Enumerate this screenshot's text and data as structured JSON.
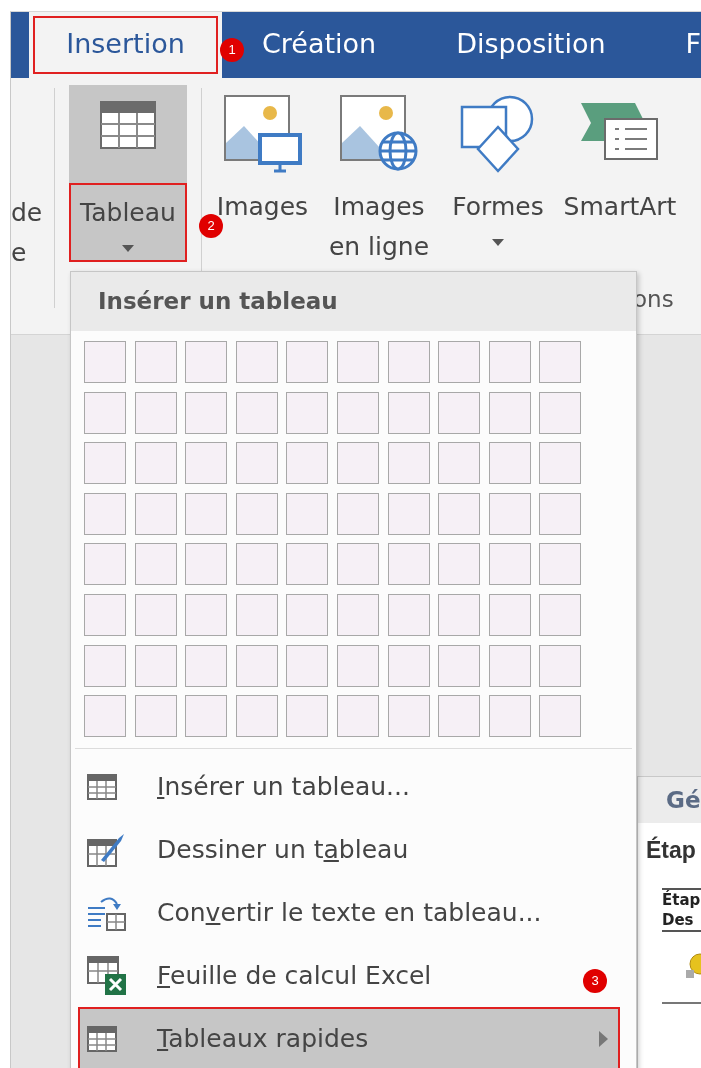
{
  "tabs": [
    {
      "label": "Insertion",
      "selected": true,
      "highlighted": true,
      "callout": "1"
    },
    {
      "label": "Création",
      "selected": false,
      "highlighted": false
    },
    {
      "label": "Disposition",
      "selected": false,
      "highlighted": false
    },
    {
      "label": "F",
      "selected": false,
      "highlighted": false
    }
  ],
  "ribbon": {
    "cut_group": {
      "lines": [
        "de",
        "e"
      ]
    },
    "buttons": [
      {
        "kind": "table",
        "lines": [
          "Tableau"
        ],
        "dropdown": true,
        "pressed": true,
        "highlighted": true,
        "callout": "2"
      },
      {
        "kind": "pictures",
        "lines": [
          "Images"
        ],
        "dropdown": false,
        "pressed": false,
        "highlighted": false
      },
      {
        "kind": "online-pictures",
        "lines": [
          "Images",
          "en ligne"
        ],
        "dropdown": false,
        "pressed": false,
        "highlighted": false
      },
      {
        "kind": "shapes",
        "lines": [
          "Formes"
        ],
        "dropdown": true,
        "pressed": false,
        "highlighted": false
      },
      {
        "kind": "smartart",
        "lines": [
          "SmartArt"
        ],
        "dropdown": false,
        "pressed": false,
        "highlighted": false
      }
    ],
    "group_label": "ons"
  },
  "menu": {
    "title": "Insérer un tableau",
    "grid": [
      [
        {
          "selected": false
        },
        {
          "selected": false
        },
        {
          "selected": false
        },
        {
          "selected": false
        },
        {
          "selected": false
        },
        {
          "selected": false
        },
        {
          "selected": false
        },
        {
          "selected": false
        },
        {
          "selected": false
        },
        {
          "selected": false
        }
      ],
      [
        {
          "selected": false
        },
        {
          "selected": false
        },
        {
          "selected": false
        },
        {
          "selected": false
        },
        {
          "selected": false
        },
        {
          "selected": false
        },
        {
          "selected": false
        },
        {
          "selected": false
        },
        {
          "selected": false
        },
        {
          "selected": false
        }
      ],
      [
        {
          "selected": false
        },
        {
          "selected": false
        },
        {
          "selected": false
        },
        {
          "selected": false
        },
        {
          "selected": false
        },
        {
          "selected": false
        },
        {
          "selected": false
        },
        {
          "selected": false
        },
        {
          "selected": false
        },
        {
          "selected": false
        }
      ],
      [
        {
          "selected": false
        },
        {
          "selected": false
        },
        {
          "selected": false
        },
        {
          "selected": false
        },
        {
          "selected": false
        },
        {
          "selected": false
        },
        {
          "selected": false
        },
        {
          "selected": false
        },
        {
          "selected": false
        },
        {
          "selected": false
        }
      ],
      [
        {
          "selected": false
        },
        {
          "selected": false
        },
        {
          "selected": false
        },
        {
          "selected": false
        },
        {
          "selected": false
        },
        {
          "selected": false
        },
        {
          "selected": false
        },
        {
          "selected": false
        },
        {
          "selected": false
        },
        {
          "selected": false
        }
      ],
      [
        {
          "selected": false
        },
        {
          "selected": false
        },
        {
          "selected": false
        },
        {
          "selected": false
        },
        {
          "selected": false
        },
        {
          "selected": false
        },
        {
          "selected": false
        },
        {
          "selected": false
        },
        {
          "selected": false
        },
        {
          "selected": false
        }
      ],
      [
        {
          "selected": false
        },
        {
          "selected": false
        },
        {
          "selected": false
        },
        {
          "selected": false
        },
        {
          "selected": false
        },
        {
          "selected": false
        },
        {
          "selected": false
        },
        {
          "selected": false
        },
        {
          "selected": false
        },
        {
          "selected": false
        }
      ],
      [
        {
          "selected": false
        },
        {
          "selected": false
        },
        {
          "selected": false
        },
        {
          "selected": false
        },
        {
          "selected": false
        },
        {
          "selected": false
        },
        {
          "selected": false
        },
        {
          "selected": false
        },
        {
          "selected": false
        },
        {
          "selected": false
        }
      ]
    ],
    "items": [
      {
        "kind": "insert-table",
        "key": "I",
        "after": "nsérer un tableau...",
        "selected": false,
        "submenu": false,
        "highlighted": false
      },
      {
        "kind": "draw-table",
        "before": "Dessiner un t",
        "key": "a",
        "after": "bleau",
        "selected": false,
        "submenu": false,
        "highlighted": false
      },
      {
        "kind": "convert",
        "before": "Con",
        "key": "v",
        "after": "ertir le texte en tableau...",
        "selected": false,
        "submenu": false,
        "highlighted": false
      },
      {
        "kind": "excel",
        "key": "F",
        "after": "euille de calcul Excel",
        "selected": false,
        "submenu": false,
        "highlighted": false
      },
      {
        "kind": "quick-tables",
        "key": "T",
        "after": "ableaux rapides",
        "selected": true,
        "submenu": true,
        "highlighted": true,
        "callout": "3"
      }
    ]
  },
  "submenu_preview": {
    "title": "Gé",
    "heading": "Étap",
    "table_lines": [
      "Étap",
      "Des"
    ]
  }
}
